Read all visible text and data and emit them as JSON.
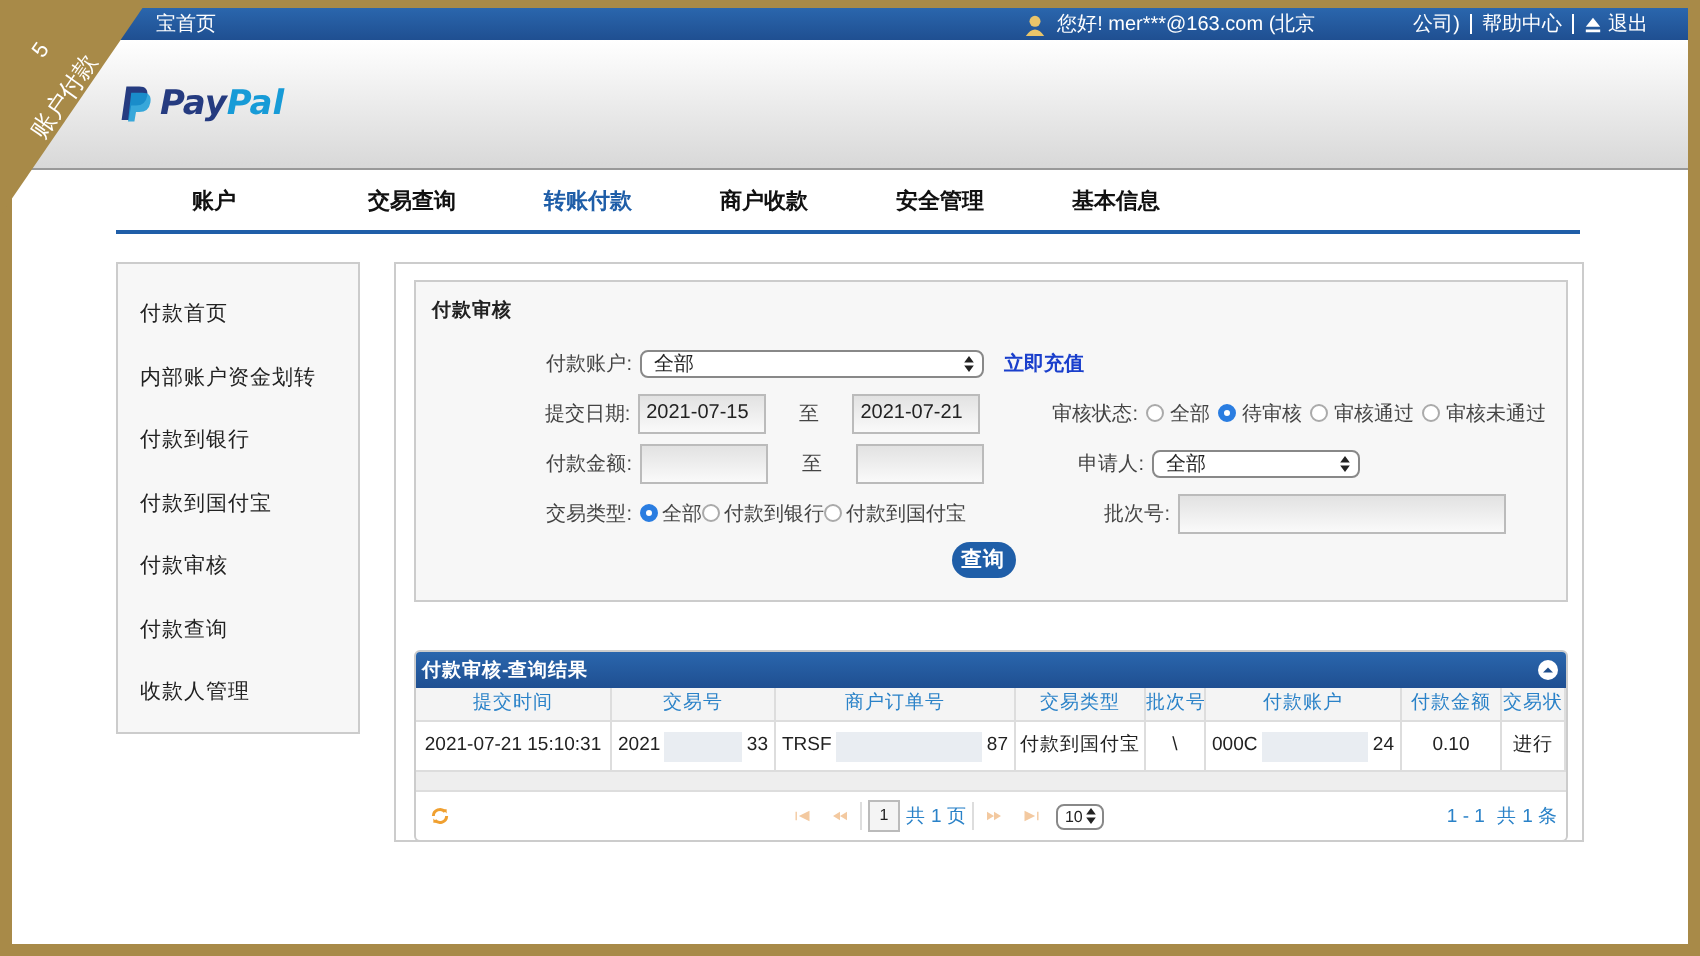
{
  "corner_banner": {
    "number": "5",
    "label": "账户付款"
  },
  "top_bar": {
    "home_link": "宝首页",
    "greeting": "您好! mer***@163.com (北京",
    "greeting_end": "公司)",
    "help": "帮助中心",
    "logout": "退出"
  },
  "logo": {
    "part1": "Pay",
    "part2": "Pal"
  },
  "nav_tabs": [
    {
      "label": "账户",
      "selected": false
    },
    {
      "label": "交易查询",
      "selected": false
    },
    {
      "label": "转账付款",
      "selected": true
    },
    {
      "label": "商户收款",
      "selected": false
    },
    {
      "label": "安全管理",
      "selected": false
    },
    {
      "label": "基本信息",
      "selected": false
    }
  ],
  "sidebar": {
    "items": [
      {
        "label": "付款首页"
      },
      {
        "label": "内部账户资金划转"
      },
      {
        "label": "付款到银行"
      },
      {
        "label": "付款到国付宝"
      },
      {
        "label": "付款审核"
      },
      {
        "label": "付款查询"
      },
      {
        "label": "收款人管理"
      }
    ]
  },
  "form": {
    "title": "付款审核",
    "account": {
      "label": "付款账户:",
      "value": "全部",
      "link": "立即充值"
    },
    "date": {
      "label": "提交日期:",
      "from": "2021-07-15",
      "to_label": "至",
      "to": "2021-07-21"
    },
    "status": {
      "label": "审核状态:",
      "options": [
        {
          "label": "全部",
          "selected": false
        },
        {
          "label": "待审核",
          "selected": true
        },
        {
          "label": "审核通过",
          "selected": false
        },
        {
          "label": "审核未通过",
          "selected": false
        }
      ]
    },
    "amount": {
      "label": "付款金额:",
      "to_label": "至"
    },
    "applicant": {
      "label": "申请人:",
      "value": "全部"
    },
    "type": {
      "label": "交易类型:",
      "options": [
        {
          "label": "全部",
          "selected": true
        },
        {
          "label": "付款到银行",
          "selected": false
        },
        {
          "label": "付款到国付宝",
          "selected": false
        }
      ]
    },
    "batch": {
      "label": "批次号:"
    },
    "submit": "查询"
  },
  "results": {
    "title": "付款审核-查询结果",
    "columns": [
      "提交时间",
      "交易号",
      "商户订单号",
      "交易类型",
      "批次号",
      "付款账户",
      "付款金额",
      "交易状"
    ],
    "rows": [
      [
        {
          "text": "2021-07-21 15:10:31"
        },
        {
          "text": "2021",
          "masked": true,
          "end": "33"
        },
        {
          "text": "TRSF",
          "masked": true,
          "end": "87"
        },
        {
          "text": "付款到国付宝"
        },
        {
          "text": "\\"
        },
        {
          "text": "000C",
          "masked": true,
          "end": "24"
        },
        {
          "text": "0.10"
        },
        {
          "text": "进行"
        }
      ]
    ],
    "pager": {
      "page": "1",
      "total_pages": "共 1 页",
      "page_size": "10",
      "range": "1 - 1",
      "total": "共 1 条"
    }
  }
}
